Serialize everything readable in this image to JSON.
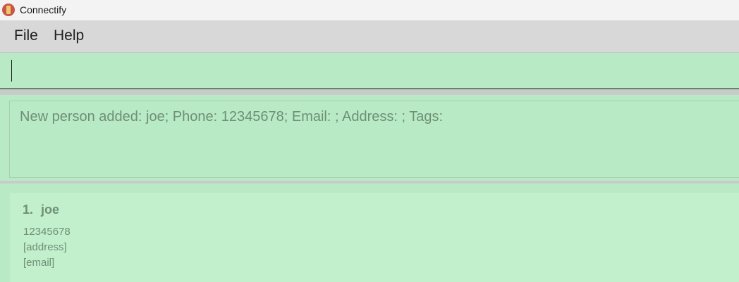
{
  "window": {
    "title": "Connectify",
    "icon": "app-logo-icon"
  },
  "menu": {
    "items": [
      "File",
      "Help"
    ]
  },
  "command_box": {
    "value": ""
  },
  "result_display": {
    "text": "New person added: joe; Phone: 12345678; Email: ; Address: ; Tags:"
  },
  "person_list": {
    "persons": [
      {
        "index": "1.",
        "name": "joe",
        "phone": "12345678",
        "address": "[address]",
        "email": "[email]"
      }
    ]
  }
}
